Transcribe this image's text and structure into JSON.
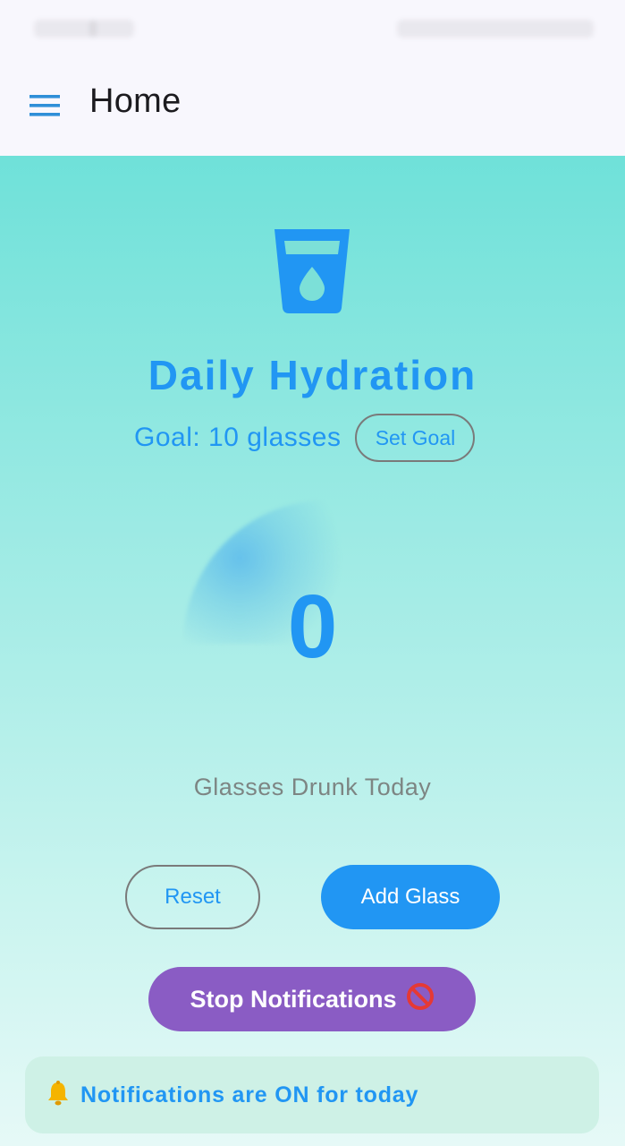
{
  "app_bar": {
    "title": "Home",
    "menu_icon": "hamburger-menu-icon"
  },
  "hydration": {
    "icon": "water-glass-icon",
    "headline": "Daily Hydration",
    "goal_text": "Goal: 10 glasses",
    "goal_target": 10,
    "set_goal_label": "Set Goal",
    "count": "0",
    "progress_fraction": 0,
    "count_label": "Glasses Drunk Today"
  },
  "actions": {
    "reset_label": "Reset",
    "add_label": "Add Glass",
    "stop_label": "Stop Notifications",
    "stop_icon": "no-entry-icon"
  },
  "notice": {
    "icon": "bell-icon",
    "text": "Notifications are ON for today"
  },
  "colors": {
    "primary": "#2196f3",
    "stop_button": "#8a5cc4",
    "notice_card": "#cef1e6",
    "background_top": "#6fe1d9",
    "background_bottom": "#e6f9f7"
  }
}
